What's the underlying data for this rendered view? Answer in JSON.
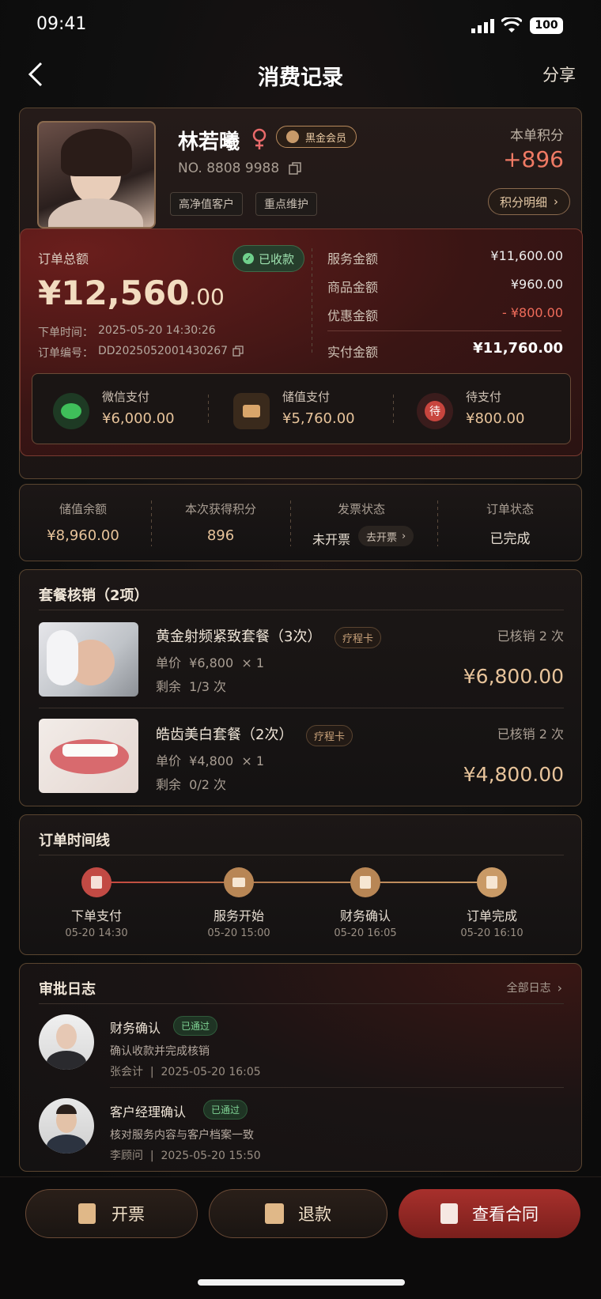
{
  "status_bar": {
    "time": "09:41",
    "battery": "100"
  },
  "nav": {
    "title": "消费记录",
    "share": "分享"
  },
  "customer": {
    "name": "林若曦",
    "member_badge": "黑金会员",
    "number": "NO. 8808 9988",
    "tags": [
      "高净值客户",
      "重点维护"
    ],
    "points_label": "本单积分",
    "points_value": "+896",
    "points_detail": "积分明细"
  },
  "order": {
    "total_label": "订单总额",
    "total_main": "¥12,560",
    "total_decimal": ".00",
    "paid_badge": "已收款",
    "time_label": "下单时间：",
    "time_value": "2025-05-20 14:30:26",
    "no_label": "订单编号：",
    "no_value": "DD2025052001430267",
    "breakdown": [
      {
        "label": "服务金额",
        "value": "¥11,600.00"
      },
      {
        "label": "商品金额",
        "value": "¥960.00"
      },
      {
        "label": "优惠金额",
        "value": "- ¥800.00"
      }
    ],
    "actual_label": "实付金额",
    "actual_value": "¥11,760.00",
    "payments": [
      {
        "label": "微信支付",
        "value": "¥6,000.00"
      },
      {
        "label": "储值支付",
        "value": "¥5,760.00"
      },
      {
        "label": "待支付",
        "value": "¥800.00",
        "icon_text": "待"
      }
    ]
  },
  "stats": [
    {
      "label": "储值余额",
      "value": "¥8,960.00"
    },
    {
      "label": "本次获得积分",
      "value": "896"
    },
    {
      "label": "发票状态",
      "value": "未开票",
      "action": "去开票"
    },
    {
      "label": "订单状态",
      "value": "已完成"
    }
  ],
  "packages": {
    "title": "套餐核销（2项）",
    "items": [
      {
        "name": "黄金射频紧致套餐（3次）",
        "tag": "疗程卡",
        "used": "已核销 2 次",
        "unit": "单价  ¥6,800  × 1",
        "remain": "剩余  1/3 次",
        "price": "¥6,800.00"
      },
      {
        "name": "皓齿美白套餐（2次）",
        "tag": "疗程卡",
        "used": "已核销 2 次",
        "unit": "单价  ¥4,800  × 1",
        "remain": "剩余  0/2 次",
        "price": "¥4,800.00"
      }
    ]
  },
  "timeline": {
    "title": "订单时间线",
    "steps": [
      {
        "label": "下单支付",
        "time": "05-20 14:30"
      },
      {
        "label": "服务开始",
        "time": "05-20 15:00"
      },
      {
        "label": "财务确认",
        "time": "05-20 16:05"
      },
      {
        "label": "订单完成",
        "time": "05-20 16:10"
      }
    ]
  },
  "approvals": {
    "title": "审批日志",
    "all": "全部日志",
    "items": [
      {
        "title": "财务确认",
        "status": "已通过",
        "desc": "确认收款并完成核销",
        "meta": "张会计  |  2025-05-20 16:05"
      },
      {
        "title": "客户经理确认",
        "status": "已通过",
        "desc": "核对服务内容与客户档案一致",
        "meta": "李顾问  |  2025-05-20 15:50"
      }
    ]
  },
  "actions": {
    "invoice": "开票",
    "refund": "退款",
    "contract": "查看合同"
  }
}
